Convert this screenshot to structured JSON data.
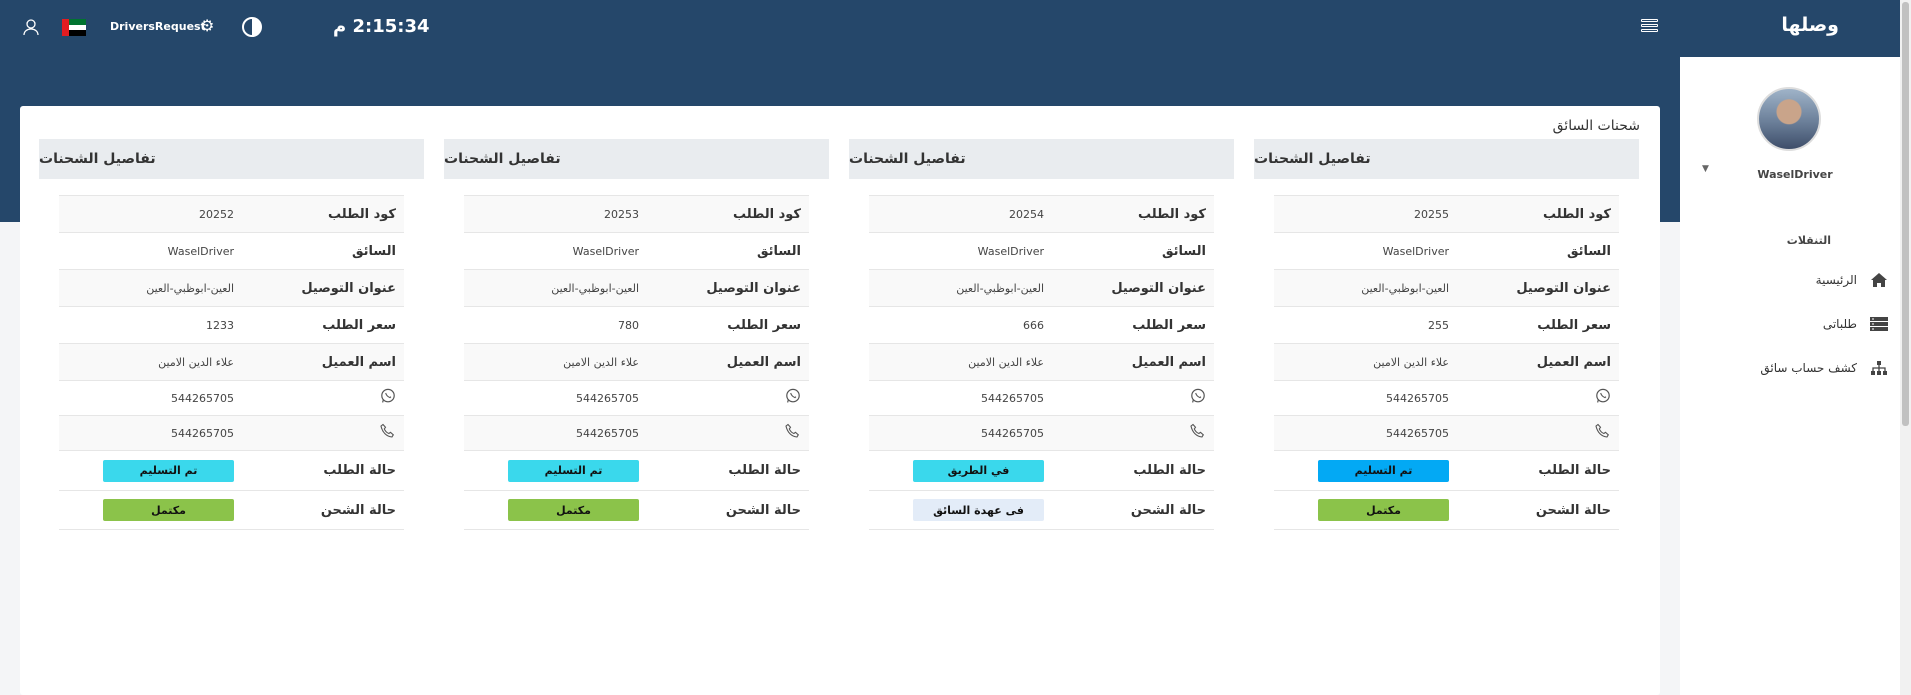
{
  "header": {
    "brand": "وصلها",
    "clock": "2:15:34 م",
    "app_name": "DriversRequest"
  },
  "sidebar": {
    "profile_name": "WaselDriver",
    "nav_heading": "التنقلات",
    "items": [
      {
        "label": "الرئيسية",
        "icon": "home-icon"
      },
      {
        "label": "طلباتى",
        "icon": "list-icon"
      },
      {
        "label": "كشف حساب سائق",
        "icon": "sitemap-icon"
      }
    ]
  },
  "main": {
    "card_title": "شحنات السائق",
    "labels": {
      "panel_title": "تفاصيل الشحنات",
      "order_code": "كود الطلب",
      "driver": "السائق",
      "address": "عنوان التوصيل",
      "price": "سعر الطلب",
      "customer": "اسم العميل",
      "order_status": "حالة الطلب",
      "shipping_status": "حالة الشحن"
    },
    "shipments": [
      {
        "code": "20255",
        "driver": "WaselDriver",
        "address": "العين-ابوظبي-العين",
        "price": "255",
        "customer": "علاء الدين الامين",
        "whatsapp": "544265705",
        "phone": "544265705",
        "order_status": "تم التسليم",
        "order_status_color": "#03a9f4",
        "shipping_status": "مكتمل",
        "shipping_status_color": "#8bc34a"
      },
      {
        "code": "20254",
        "driver": "WaselDriver",
        "address": "العين-ابوظبي-العين",
        "price": "666",
        "customer": "علاء الدين الامين",
        "whatsapp": "544265705",
        "phone": "544265705",
        "order_status": "في الطريق",
        "order_status_color": "#3ad8ec",
        "shipping_status": "فى عهدة السائق",
        "shipping_status_color": "#e3ecf8"
      },
      {
        "code": "20253",
        "driver": "WaselDriver",
        "address": "العين-ابوظبي-العين",
        "price": "780",
        "customer": "علاء الدين الامين",
        "whatsapp": "544265705",
        "phone": "544265705",
        "order_status": "تم التسليم",
        "order_status_color": "#3ad8ec",
        "shipping_status": "مكتمل",
        "shipping_status_color": "#8bc34a"
      },
      {
        "code": "20252",
        "driver": "WaselDriver",
        "address": "العين-ابوظبي-العين",
        "price": "1233",
        "customer": "علاء الدين الامين",
        "whatsapp": "544265705",
        "phone": "544265705",
        "order_status": "تم التسليم",
        "order_status_color": "#3ad8ec",
        "shipping_status": "مكتمل",
        "shipping_status_color": "#8bc34a"
      }
    ]
  }
}
